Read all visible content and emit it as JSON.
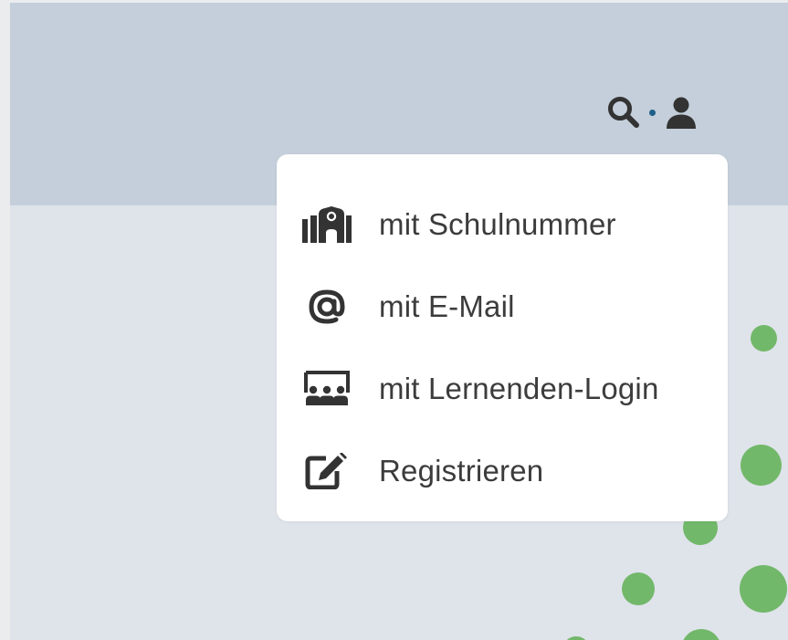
{
  "header": {
    "icons": [
      {
        "name": "search-icon"
      },
      {
        "name": "user-icon"
      }
    ]
  },
  "login_menu": {
    "items": [
      {
        "label": "mit Schulnummer",
        "icon": "school-icon"
      },
      {
        "label": "mit E-Mail",
        "icon": "at-sign-icon"
      },
      {
        "label": "mit Lernenden-Login",
        "icon": "classroom-icon"
      },
      {
        "label": "Registrieren",
        "icon": "edit-icon"
      }
    ]
  },
  "colors": {
    "header_bg": "#c4cfdb",
    "page_bg": "#dfe3ea",
    "menu_bg": "#ffffff",
    "text": "#3c3c3c",
    "icon": "#333333",
    "separator_dot": "#1f5f8b",
    "bubble": "#72b86a"
  }
}
